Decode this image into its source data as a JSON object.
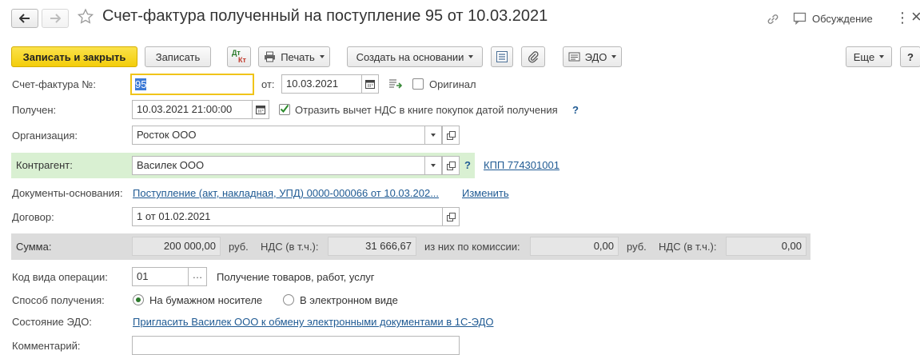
{
  "window": {
    "title": "Счет-фактура полученный на поступление 95 от 10.03.2021",
    "discussion_label": "Обсуждение",
    "more_glyph": "⋮",
    "close_glyph": "×"
  },
  "toolbar": {
    "save_close": "Записать и закрыть",
    "save": "Записать",
    "dt_kt_top": "Дт",
    "dt_kt_bottom": "Кт",
    "print": "Печать",
    "create_based": "Создать на основании",
    "edo": "ЭДО",
    "more": "Еще",
    "help": "?"
  },
  "form": {
    "invoice_label": "Счет-фактура №:",
    "invoice_number": "95",
    "from_label": "от:",
    "invoice_date": "10.03.2021",
    "original_label": "Оригинал",
    "original_checked": false,
    "received_label": "Получен:",
    "received_datetime": "10.03.2021 21:00:00",
    "vat_deduction_label": "Отразить вычет НДС в книге покупок датой получения",
    "vat_deduction_checked": true,
    "organization_label": "Организация:",
    "organization": "Росток ООО",
    "counterparty_label": "Контрагент:",
    "counterparty": "Василек ООО",
    "kpp_link": "КПП 774301001",
    "base_docs_label": "Документы-основания:",
    "base_docs_link": "Поступление (акт, накладная, УПД) 0000-000066 от 10.03.202...",
    "change_link": "Изменить",
    "contract_label": "Договор:",
    "contract": "1 от 01.02.2021",
    "sum_label": "Сумма:",
    "sum": "200 000,00",
    "currency": "руб.",
    "vat_label": "НДС (в т.ч.):",
    "vat": "31 666,67",
    "commission_label": "из них по комиссии:",
    "commission_sum": "0,00",
    "commission_currency": "руб.",
    "commission_vat_label": "НДС (в т.ч.):",
    "commission_vat": "0,00",
    "op_code_label": "Код вида операции:",
    "op_code": "01",
    "op_code_desc": "Получение товаров, работ, услуг",
    "receipt_method_label": "Способ получения:",
    "receipt_paper": "На бумажном носителе",
    "receipt_electronic": "В электронном виде",
    "receipt_selected": "paper",
    "edo_state_label": "Состояние ЭДО:",
    "edo_state_link": "Пригласить Василек ООО к обмену электронными документами в 1С-ЭДО",
    "comment_label": "Комментарий:",
    "comment": ""
  },
  "colors": {
    "primary_button": "#f3cd0a",
    "counterparty_highlight": "#d9f0d2",
    "sum_band": "#dcdcdc",
    "link": "#1f5a93",
    "invoice_focus": "#f0c419"
  }
}
